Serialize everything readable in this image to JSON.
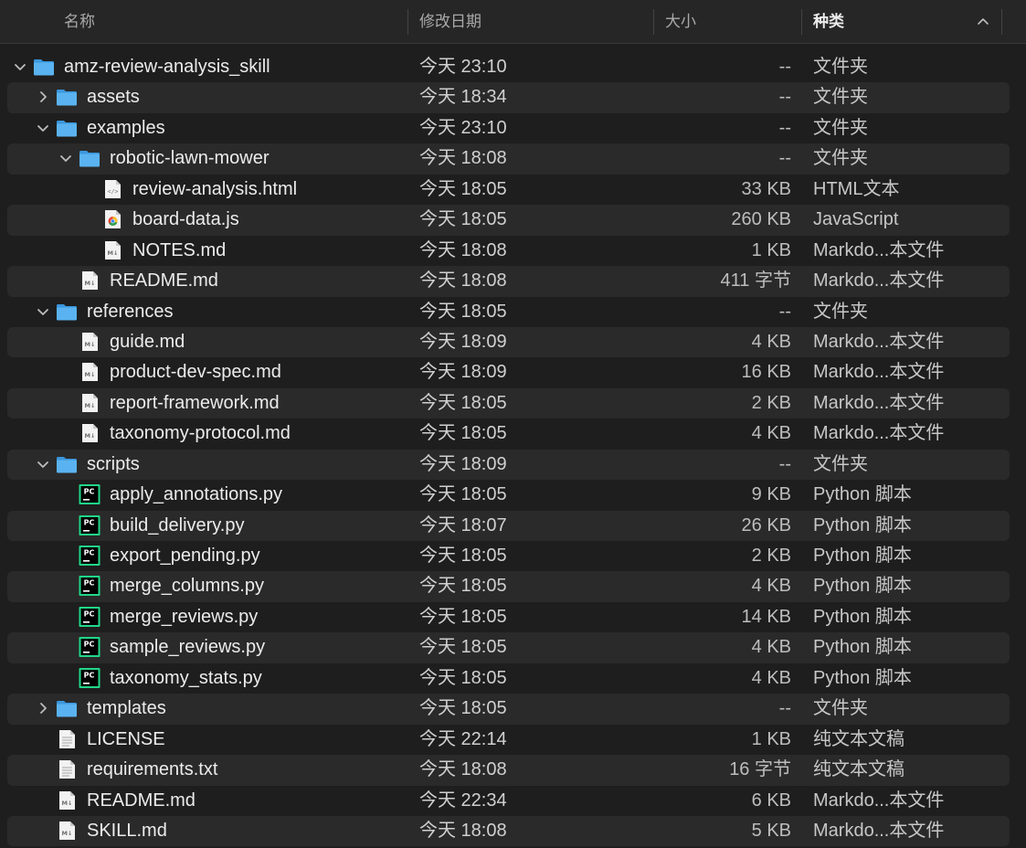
{
  "header": {
    "name": "名称",
    "date": "修改日期",
    "size": "大小",
    "kind": "种类"
  },
  "rows": [
    {
      "name": "amz-review-analysis_skill",
      "date": "今天 23:10",
      "size": "--",
      "kind": "文件夹",
      "icon": "folder-icon",
      "level": 0,
      "disclosure": "expanded"
    },
    {
      "name": "assets",
      "date": "今天 18:34",
      "size": "--",
      "kind": "文件夹",
      "icon": "folder-icon",
      "level": 1,
      "disclosure": "collapsed"
    },
    {
      "name": "examples",
      "date": "今天 23:10",
      "size": "--",
      "kind": "文件夹",
      "icon": "folder-icon",
      "level": 1,
      "disclosure": "expanded"
    },
    {
      "name": "robotic-lawn-mower",
      "date": "今天 18:08",
      "size": "--",
      "kind": "文件夹",
      "icon": "folder-icon",
      "level": 2,
      "disclosure": "expanded"
    },
    {
      "name": "review-analysis.html",
      "date": "今天 18:05",
      "size": "33 KB",
      "kind": "HTML文本",
      "icon": "html-file-icon",
      "level": 3,
      "disclosure": "none"
    },
    {
      "name": "board-data.js",
      "date": "今天 18:05",
      "size": "260 KB",
      "kind": "JavaScript",
      "icon": "js-file-icon",
      "level": 3,
      "disclosure": "none"
    },
    {
      "name": "NOTES.md",
      "date": "今天 18:08",
      "size": "1 KB",
      "kind": "Markdo...本文件",
      "icon": "markdown-file-icon",
      "level": 3,
      "disclosure": "none"
    },
    {
      "name": "README.md",
      "date": "今天 18:08",
      "size": "411 字节",
      "kind": "Markdo...本文件",
      "icon": "markdown-file-icon",
      "level": 2,
      "disclosure": "none"
    },
    {
      "name": "references",
      "date": "今天 18:05",
      "size": "--",
      "kind": "文件夹",
      "icon": "folder-icon",
      "level": 1,
      "disclosure": "expanded"
    },
    {
      "name": "guide.md",
      "date": "今天 18:09",
      "size": "4 KB",
      "kind": "Markdo...本文件",
      "icon": "markdown-file-icon",
      "level": 2,
      "disclosure": "none"
    },
    {
      "name": "product-dev-spec.md",
      "date": "今天 18:09",
      "size": "16 KB",
      "kind": "Markdo...本文件",
      "icon": "markdown-file-icon",
      "level": 2,
      "disclosure": "none"
    },
    {
      "name": "report-framework.md",
      "date": "今天 18:05",
      "size": "2 KB",
      "kind": "Markdo...本文件",
      "icon": "markdown-file-icon",
      "level": 2,
      "disclosure": "none"
    },
    {
      "name": "taxonomy-protocol.md",
      "date": "今天 18:05",
      "size": "4 KB",
      "kind": "Markdo...本文件",
      "icon": "markdown-file-icon",
      "level": 2,
      "disclosure": "none"
    },
    {
      "name": "scripts",
      "date": "今天 18:09",
      "size": "--",
      "kind": "文件夹",
      "icon": "folder-icon",
      "level": 1,
      "disclosure": "expanded"
    },
    {
      "name": "apply_annotations.py",
      "date": "今天 18:05",
      "size": "9 KB",
      "kind": "Python 脚本",
      "icon": "python-file-icon",
      "level": 2,
      "disclosure": "none"
    },
    {
      "name": "build_delivery.py",
      "date": "今天 18:07",
      "size": "26 KB",
      "kind": "Python 脚本",
      "icon": "python-file-icon",
      "level": 2,
      "disclosure": "none"
    },
    {
      "name": "export_pending.py",
      "date": "今天 18:05",
      "size": "2 KB",
      "kind": "Python 脚本",
      "icon": "python-file-icon",
      "level": 2,
      "disclosure": "none"
    },
    {
      "name": "merge_columns.py",
      "date": "今天 18:05",
      "size": "4 KB",
      "kind": "Python 脚本",
      "icon": "python-file-icon",
      "level": 2,
      "disclosure": "none"
    },
    {
      "name": "merge_reviews.py",
      "date": "今天 18:05",
      "size": "14 KB",
      "kind": "Python 脚本",
      "icon": "python-file-icon",
      "level": 2,
      "disclosure": "none"
    },
    {
      "name": "sample_reviews.py",
      "date": "今天 18:05",
      "size": "4 KB",
      "kind": "Python 脚本",
      "icon": "python-file-icon",
      "level": 2,
      "disclosure": "none"
    },
    {
      "name": "taxonomy_stats.py",
      "date": "今天 18:05",
      "size": "4 KB",
      "kind": "Python 脚本",
      "icon": "python-file-icon",
      "level": 2,
      "disclosure": "none"
    },
    {
      "name": "templates",
      "date": "今天 18:05",
      "size": "--",
      "kind": "文件夹",
      "icon": "folder-icon",
      "level": 1,
      "disclosure": "collapsed"
    },
    {
      "name": "LICENSE",
      "date": "今天 22:14",
      "size": "1 KB",
      "kind": "纯文本文稿",
      "icon": "text-file-icon",
      "level": 1,
      "disclosure": "none"
    },
    {
      "name": "requirements.txt",
      "date": "今天 18:08",
      "size": "16 字节",
      "kind": "纯文本文稿",
      "icon": "text-file-icon",
      "level": 1,
      "disclosure": "none"
    },
    {
      "name": "README.md",
      "date": "今天 22:34",
      "size": "6 KB",
      "kind": "Markdo...本文件",
      "icon": "markdown-file-icon",
      "level": 1,
      "disclosure": "none"
    },
    {
      "name": "SKILL.md",
      "date": "今天 18:08",
      "size": "5 KB",
      "kind": "Markdo...本文件",
      "icon": "markdown-file-icon",
      "level": 1,
      "disclosure": "none"
    }
  ],
  "colors": {
    "folder": "#4aa8ec",
    "python": "#21d789",
    "background": "#1e1e1e",
    "row_alt": "#2a2a2a"
  }
}
